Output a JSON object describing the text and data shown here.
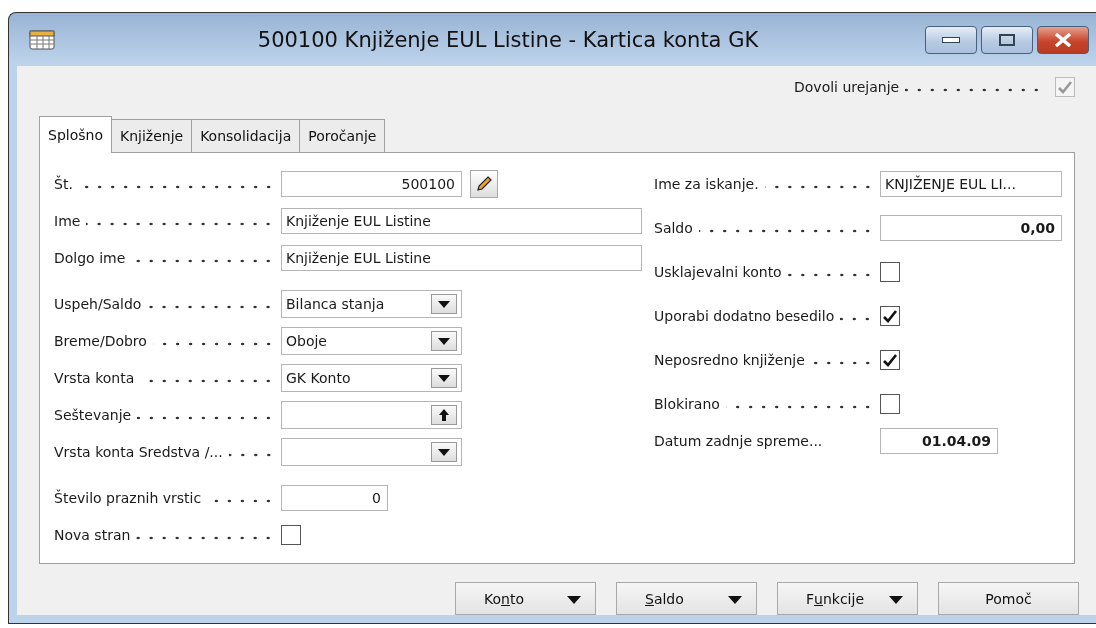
{
  "window": {
    "title": "500100 Knjiženje EUL Listine - Kartica konta GK"
  },
  "allow_edit": {
    "label": "Dovoli urejanje",
    "checked": true,
    "disabled": true
  },
  "tabs": [
    {
      "label": "Splošno",
      "selected": true
    },
    {
      "label": "Knjiženje",
      "selected": false
    },
    {
      "label": "Konsolidacija",
      "selected": false
    },
    {
      "label": "Poročanje",
      "selected": false
    }
  ],
  "left_groups": [
    [
      {
        "label": "Št.",
        "kind": "numberedit",
        "value": "500100"
      },
      {
        "label": "Ime",
        "kind": "wide",
        "value": "Knjiženje EUL Listine"
      },
      {
        "label": "Dolgo ime",
        "kind": "wide",
        "value": "Knjiženje EUL Listine"
      }
    ],
    [
      {
        "label": "Uspeh/Saldo",
        "kind": "select",
        "value": "Bilanca stanja"
      },
      {
        "label": "Breme/Dobro",
        "kind": "select",
        "value": "Oboje"
      },
      {
        "label": "Vrsta konta",
        "kind": "select",
        "value": "GK Konto"
      },
      {
        "label": "Seštevanje",
        "kind": "assist"
      },
      {
        "label": "Vrsta konta Sredstva /...",
        "kind": "select"
      }
    ],
    [
      {
        "label": "Število praznih vrstic",
        "kind": "number",
        "value": "0"
      },
      {
        "label": "Nova stran",
        "kind": "checkbox",
        "checked": false
      }
    ]
  ],
  "right_fields": [
    {
      "label": "Ime za iskanje.",
      "kind": "text",
      "value": "KNJIŽENJE EUL LI..."
    },
    {
      "label": "Saldo",
      "kind": "amount",
      "value": "0,00"
    },
    {
      "label": "Usklajevalni konto",
      "kind": "checkbox",
      "checked": false
    },
    {
      "label": "Uporabi dodatno besedilo",
      "kind": "checkbox",
      "checked": true
    },
    {
      "label": "Neposredno knjiženje",
      "kind": "checkbox",
      "checked": true
    },
    {
      "label": "Blokirano",
      "kind": "checkbox",
      "checked": false
    },
    {
      "label": "Datum zadnje spreme...",
      "kind": "date",
      "value": "01.04.09"
    }
  ],
  "buttons": [
    {
      "before": "Ko",
      "key": "n",
      "after": "to",
      "menu": true
    },
    {
      "key": "S",
      "after": "aldo",
      "menu": true
    },
    {
      "before": "F",
      "key": "u",
      "after": "nkcije",
      "menu": true
    },
    {
      "before": "Pomoč",
      "menu": false
    }
  ]
}
